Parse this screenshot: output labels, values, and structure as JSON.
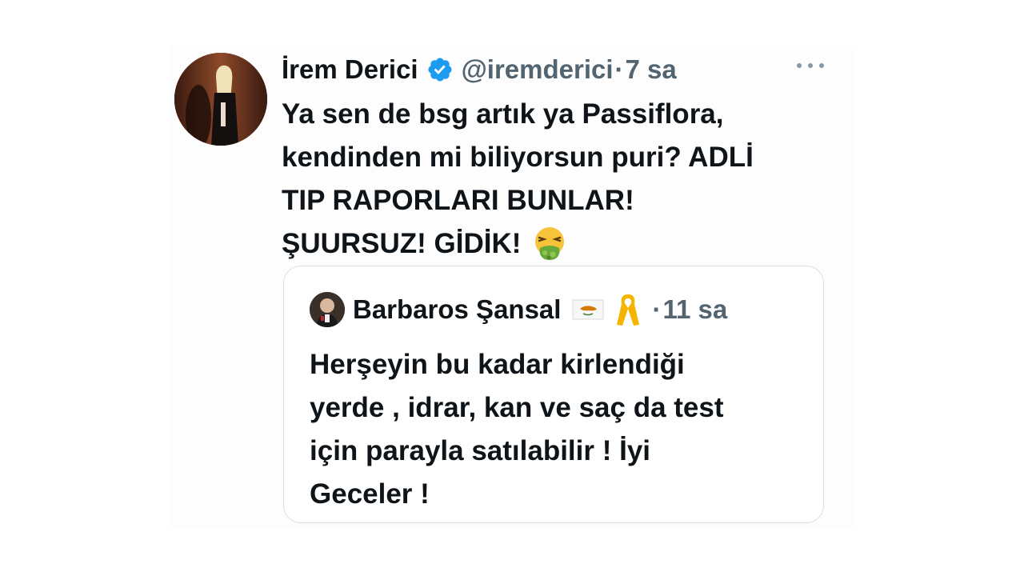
{
  "tweet": {
    "author": {
      "display_name": "İrem Derici",
      "handle": "@iremderici",
      "verified": true
    },
    "separator": "·",
    "time_ago": "7 sa",
    "lines": [
      "Ya sen de bsg artık ya Passiflora,",
      "kendinden mi biliyorsun puri? ADLİ",
      "TIP RAPORLARI BUNLAR!",
      "ŞUURSUZ! GİDİK!"
    ],
    "emoji": "nauseated-face-vomiting-icon",
    "more_icon": "more-horizontal-icon"
  },
  "quoted_tweet": {
    "author": {
      "display_name": "Barbaros Şansal",
      "flag": "cyprus-flag-icon",
      "ribbon": "yellow-ribbon-icon"
    },
    "separator": "·",
    "time_ago": "11 sa",
    "lines": [
      "Herşeyin bu kadar kirlendiği",
      "yerde , idrar, kan ve saç da test",
      "için parayla satılabilir ! İyi",
      "Geceler !"
    ]
  },
  "colors": {
    "text_primary": "#0f1419",
    "text_secondary": "#536471",
    "verified_blue": "#1d9bf0",
    "border": "#d9dfe3"
  }
}
